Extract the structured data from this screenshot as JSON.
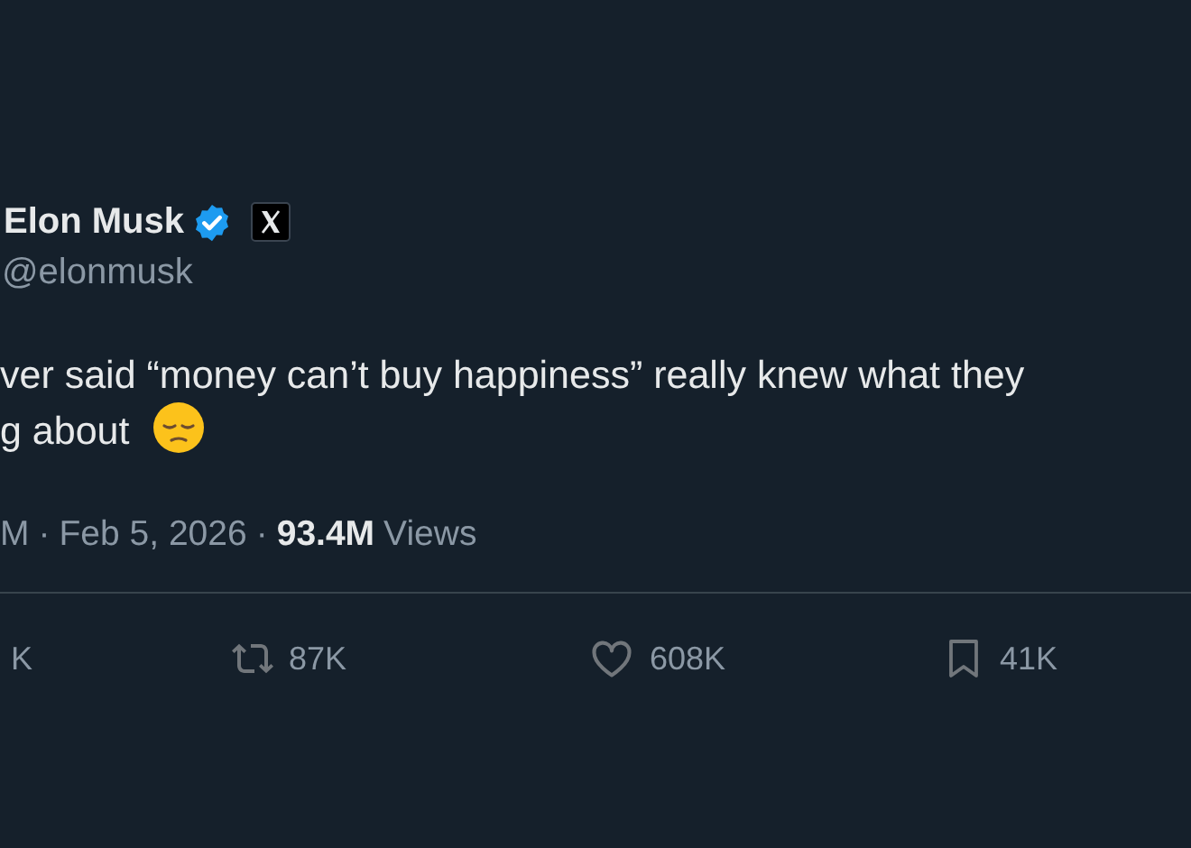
{
  "post": {
    "author": {
      "name": "Elon Musk",
      "verified": true,
      "affiliate_badge": true,
      "handle": "@elonmusk"
    },
    "text_lines": [
      "ver said “money can’t buy happiness” really knew what they",
      "g about"
    ],
    "emoji": true,
    "meta": {
      "time": "M",
      "separator": "·",
      "date": "Feb 5, 2026",
      "views_count": "93.4M",
      "views_label": "Views"
    },
    "actions": [
      {
        "kind": "reply",
        "count": "K"
      },
      {
        "kind": "repost",
        "count": "87K"
      },
      {
        "kind": "like",
        "count": "608K"
      },
      {
        "kind": "bookmark",
        "count": "41K"
      }
    ]
  }
}
